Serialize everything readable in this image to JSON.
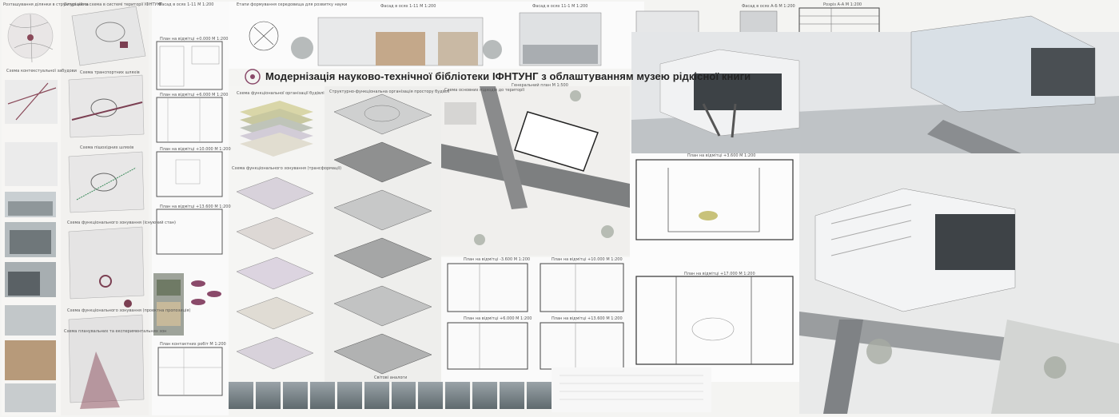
{
  "title": "Модернізація науково-технічної бібліотеки ІФНТУНГ з облаштуванням музею рідкісної книги",
  "captions": {
    "c1": "Розташування ділянки в структурі міста",
    "c2": "Ситуаційна схема в системі території ІФНТУНГ",
    "c3": "Схема контекстуальної забудови",
    "c4": "Схема транспортних шляхів",
    "c5": "Схема пішохідних шляхів",
    "c6": "Схема функціонального зонування (існуючий стан)",
    "c7": "Схема функціонального зонування (проектна пропозиція)",
    "c8": "Схема планувальних та експериментальних зон",
    "c9": "Фасад в осях 1-11 М 1:200",
    "c10": "Фасад в осях 11-1 М 1:200",
    "c11": "Фасад в осях А-Б М 1:200",
    "c12": "Розріз А-А М 1:200",
    "c13": "План на відмітці +0.000 М 1:200",
    "c14": "План на відмітці +6.000 М 1:200",
    "c15": "План на відмітці +10.000 М 1:200",
    "c16": "План на відмітці +13.600 М 1:200",
    "c17": "Схема функціональної організації будівлі",
    "c18": "Схема функціонального зонування (трансформації)",
    "c19": "Структурно-функціональна організація простору будівлі",
    "c20": "Генеральний план М 1:500",
    "c21": "Схема основних підходів до території",
    "c22": "План на відмітці -3.600 М 1:200",
    "c23": "План на відмітці +17.000 М 1:200",
    "c24": "План на відмітці +3.600 М 1:200",
    "c25": "Світові аналоги",
    "c26": "План контактних робіт М 1:200",
    "c27": "Етапи формування середовища для розвитку науки"
  }
}
